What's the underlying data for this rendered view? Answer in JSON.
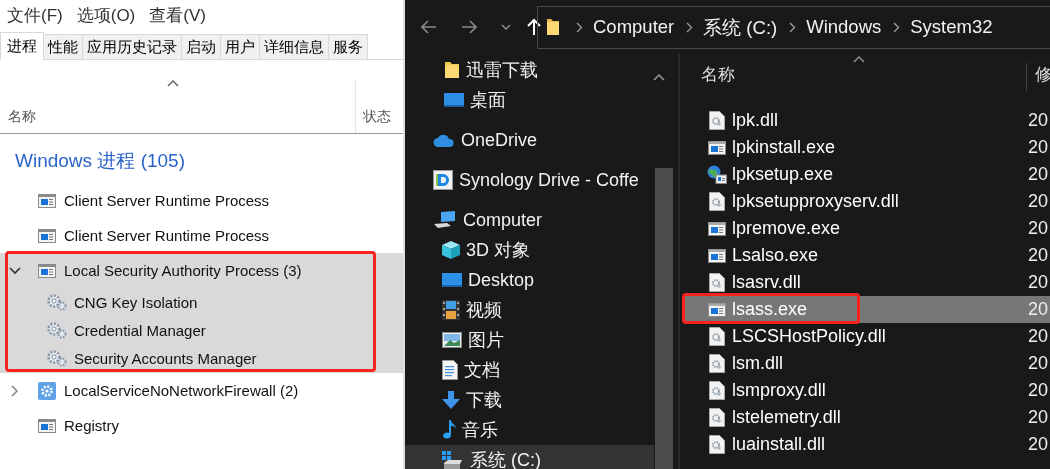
{
  "task_manager": {
    "menu": [
      "文件(F)",
      "选项(O)",
      "查看(V)"
    ],
    "tabs": [
      {
        "label": "进程",
        "selected": true
      },
      {
        "label": "性能",
        "selected": false
      },
      {
        "label": "应用历史记录",
        "selected": false
      },
      {
        "label": "启动",
        "selected": false
      },
      {
        "label": "用户",
        "selected": false
      },
      {
        "label": "详细信息",
        "selected": false
      },
      {
        "label": "服务",
        "selected": false
      }
    ],
    "columns": [
      "名称",
      "状态"
    ],
    "group_title": "Windows 进程 (105)",
    "processes": [
      {
        "name": "Client Server Runtime Process",
        "kind": "app",
        "selected": false,
        "annotated": false
      },
      {
        "name": "Client Server Runtime Process",
        "kind": "app",
        "selected": false,
        "annotated": false
      },
      {
        "name": "Local Security Authority Process (3)",
        "kind": "app",
        "selected": true,
        "annotated": true,
        "expanded": true,
        "children": [
          {
            "name": "CNG Key Isolation",
            "kind": "service"
          },
          {
            "name": "Credential Manager",
            "kind": "service"
          },
          {
            "name": "Security Accounts Manager",
            "kind": "service"
          }
        ]
      },
      {
        "name": "LocalServiceNoNetworkFirewall (2)",
        "kind": "group",
        "selected": false,
        "annotated": false,
        "expanded": false
      },
      {
        "name": "Registry",
        "kind": "app",
        "selected": false,
        "annotated": false
      }
    ]
  },
  "explorer": {
    "nav_buttons": [
      {
        "kind": "back",
        "disabled": true
      },
      {
        "kind": "forward",
        "disabled": true
      },
      {
        "kind": "recent",
        "disabled": true
      },
      {
        "kind": "up",
        "disabled": false
      }
    ],
    "breadcrumb": [
      "Computer",
      "系统 (C:)",
      "Windows",
      "System32"
    ],
    "quick_access_items": [
      {
        "label": "迅雷下载",
        "kind": "folder",
        "selected": false
      },
      {
        "label": "桌面",
        "kind": "desktop",
        "selected": false
      }
    ],
    "locations": [
      {
        "label": "OneDrive",
        "kind": "cloud",
        "selected": false
      },
      {
        "label": "Synology Drive - Coffe",
        "kind": "sync",
        "selected": false
      },
      {
        "label": "Computer",
        "kind": "computer",
        "selected": false,
        "children": [
          {
            "label": "3D 对象",
            "kind": "objects",
            "selected": false
          },
          {
            "label": "Desktop",
            "kind": "desktop",
            "selected": false
          },
          {
            "label": "视频",
            "kind": "videos",
            "selected": false
          },
          {
            "label": "图片",
            "kind": "pictures",
            "selected": false
          },
          {
            "label": "文档",
            "kind": "documents",
            "selected": false
          },
          {
            "label": "下载",
            "kind": "downloads",
            "selected": false
          },
          {
            "label": "音乐",
            "kind": "music",
            "selected": false
          },
          {
            "label": "系统 (C:)",
            "kind": "drive",
            "selected": true
          }
        ]
      }
    ],
    "columns": [
      "名称",
      "修"
    ],
    "files": [
      {
        "name": "lpk.dll",
        "kind": "dll",
        "date": "20",
        "selected": false,
        "annotated": false
      },
      {
        "name": "lpkinstall.exe",
        "kind": "exe",
        "date": "20",
        "selected": false,
        "annotated": false
      },
      {
        "name": "lpksetup.exe",
        "kind": "setup",
        "date": "20",
        "selected": false,
        "annotated": false
      },
      {
        "name": "lpksetupproxyserv.dll",
        "kind": "dll",
        "date": "20",
        "selected": false,
        "annotated": false
      },
      {
        "name": "lpremove.exe",
        "kind": "exe",
        "date": "20",
        "selected": false,
        "annotated": false
      },
      {
        "name": "Lsalso.exe",
        "kind": "exe",
        "date": "20",
        "selected": false,
        "annotated": false
      },
      {
        "name": "lsasrv.dll",
        "kind": "dll",
        "date": "20",
        "selected": false,
        "annotated": false
      },
      {
        "name": "lsass.exe",
        "kind": "exe",
        "date": "20",
        "selected": true,
        "annotated": true
      },
      {
        "name": "LSCSHostPolicy.dll",
        "kind": "dll",
        "date": "20",
        "selected": false,
        "annotated": false
      },
      {
        "name": "lsm.dll",
        "kind": "dll",
        "date": "20",
        "selected": false,
        "annotated": false
      },
      {
        "name": "lsmproxy.dll",
        "kind": "dll",
        "date": "20",
        "selected": false,
        "annotated": false
      },
      {
        "name": "lstelemetry.dll",
        "kind": "dll",
        "date": "20",
        "selected": false,
        "annotated": false
      },
      {
        "name": "luainstall.dll",
        "kind": "dll",
        "date": "20",
        "selected": false,
        "annotated": false
      }
    ]
  }
}
